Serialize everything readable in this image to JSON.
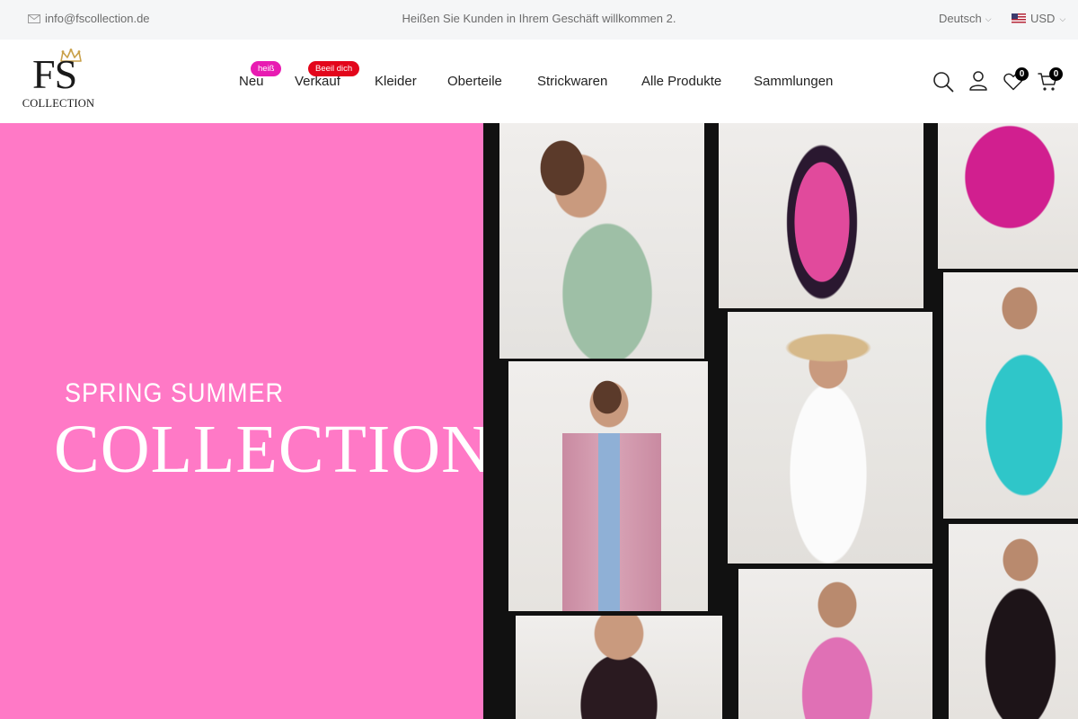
{
  "topbar": {
    "email": "info@fscollection.de",
    "welcome": "Heißen Sie Kunden in Ihrem Geschäft willkommen 2.",
    "language": "Deutsch",
    "currency": "USD"
  },
  "logo": {
    "monogram": "FS",
    "wordmark": "COLLECTION"
  },
  "nav": {
    "items": [
      {
        "label": "Neu",
        "badge": "heiß"
      },
      {
        "label": "Verkauf",
        "badge": "Beeil dich"
      },
      {
        "label": "Kleider"
      },
      {
        "label": "Oberteile"
      },
      {
        "label": "Strickwaren"
      },
      {
        "label": "Alle Produkte"
      },
      {
        "label": "Sammlungen"
      }
    ]
  },
  "header_icons": {
    "wishlist_count": "0",
    "cart_count": "0"
  },
  "hero": {
    "subtitle": "SPRING SUMMER",
    "title": "COLLECTION",
    "background_color": "#ff79c6"
  },
  "colors": {
    "badge_hot": "#e81bb2",
    "badge_sale": "#e3061b",
    "topbar_bg": "#f5f6f7"
  }
}
